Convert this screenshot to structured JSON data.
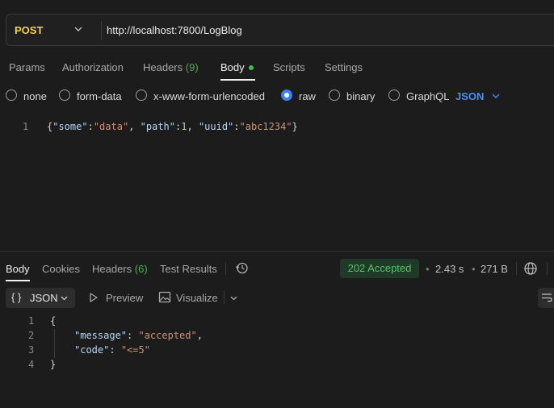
{
  "request": {
    "method": "POST",
    "url": "http://localhost:7800/LogBlog"
  },
  "request_tabs": {
    "params": "Params",
    "authorization": "Authorization",
    "headers": "Headers",
    "headers_count": "(9)",
    "body": "Body",
    "scripts": "Scripts",
    "settings": "Settings"
  },
  "body_types": {
    "none": "none",
    "form_data": "form-data",
    "urlencoded": "x-www-form-urlencoded",
    "raw": "raw",
    "binary": "binary",
    "graphql": "GraphQL",
    "selected_format": "JSON"
  },
  "request_body": {
    "line_number": "1",
    "tokens": {
      "t1": "{",
      "t2": "\"some\"",
      "t3": ":",
      "t4": "\"data\"",
      "t5": ", ",
      "t6": "\"path\"",
      "t7": ":",
      "t8": "1",
      "t9": ", ",
      "t10": "\"uuid\"",
      "t11": ":",
      "t12": "\"abc1234\"",
      "t13": "}"
    }
  },
  "response_tabs": {
    "body": "Body",
    "cookies": "Cookies",
    "headers": "Headers",
    "headers_count": "(6)",
    "test_results": "Test Results"
  },
  "response_meta": {
    "status": "202 Accepted",
    "time": "2.43 s",
    "size": "271 B",
    "separator": "•"
  },
  "response_toolbar": {
    "format_braces": "{ }",
    "format": "JSON",
    "preview": "Preview",
    "visualize": "Visualize"
  },
  "response_body": {
    "lines": [
      {
        "n": "1",
        "open": "{"
      },
      {
        "n": "2",
        "key": "\"message\"",
        "colon": ": ",
        "value": "\"accepted\"",
        "comma": ","
      },
      {
        "n": "3",
        "key": "\"code\"",
        "colon": ": ",
        "value": "\"<=5\""
      },
      {
        "n": "4",
        "close": "}"
      }
    ]
  },
  "colors": {
    "method": "#f2d25c",
    "accent": "#3b82f6",
    "status_ok": "#58c46a",
    "string": "#ce9178",
    "key": "#b8d7f4"
  }
}
